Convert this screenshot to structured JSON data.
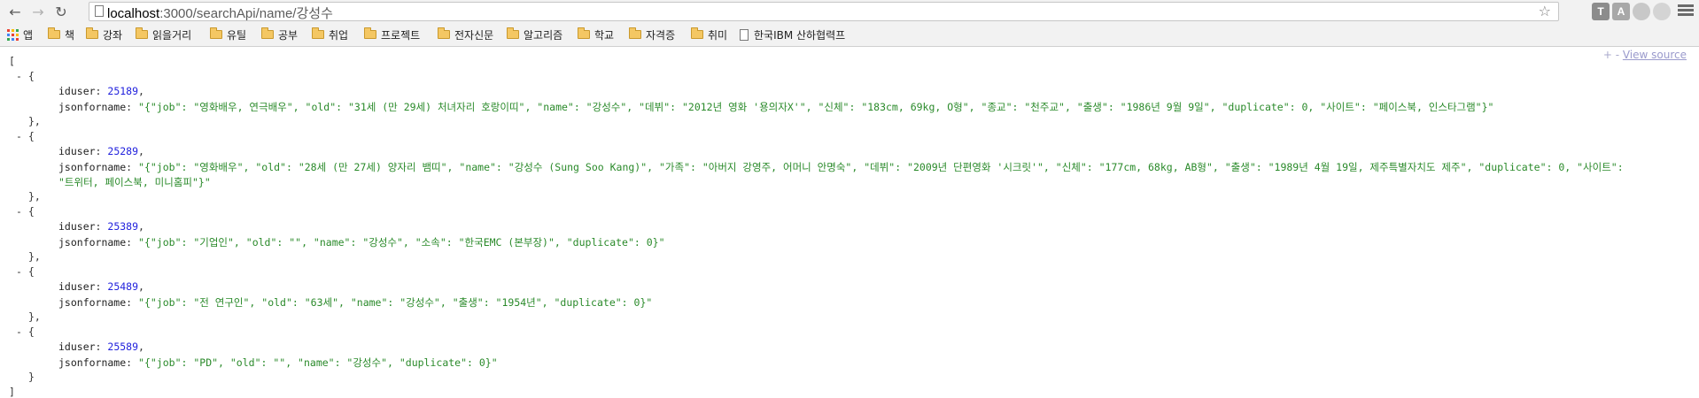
{
  "browser": {
    "url_host": "localhost",
    "url_rest": ":3000/searchApi/name/강성수",
    "extensions": [
      "T",
      "A",
      "",
      ""
    ]
  },
  "bookmarks": [
    {
      "label": "앱",
      "type": "apps"
    },
    {
      "label": "책",
      "type": "folder"
    },
    {
      "label": "강좌",
      "type": "folder"
    },
    {
      "label": "읽을거리",
      "type": "folder"
    },
    {
      "label": "유틸",
      "type": "folder"
    },
    {
      "label": "공부",
      "type": "folder"
    },
    {
      "label": "취업",
      "type": "folder"
    },
    {
      "label": "프로젝트",
      "type": "folder"
    },
    {
      "label": "전자신문",
      "type": "folder"
    },
    {
      "label": "알고리즘",
      "type": "folder"
    },
    {
      "label": "학교",
      "type": "folder"
    },
    {
      "label": "자격증",
      "type": "folder"
    },
    {
      "label": "취미",
      "type": "folder"
    },
    {
      "label": "한국IBM 산하협력프",
      "type": "page"
    }
  ],
  "viewer": {
    "collapse_all": "+ -",
    "view_source": "View source"
  },
  "json": {
    "open_bracket": "[",
    "close_bracket": "]",
    "toggle": "-",
    "open_brace": "{",
    "close_brace_comma": "},",
    "close_brace": "}",
    "key_iduser": "iduser",
    "key_jsonforname": "jsonforname",
    "records": [
      {
        "iduser": "25189",
        "jsonforname": "\"{\"job\": \"영화배우, 연극배우\", \"old\": \"31세 (만 29세) 처녀자리 호랑이띠\", \"name\": \"강성수\", \"데뷔\": \"2012년 영화 '용의자X'\", \"신체\": \"183cm, 69kg, O형\", \"종교\": \"천주교\", \"출생\": \"1986년 9월 9일\", \"duplicate\": 0, \"사이트\": \"페이스북, 인스타그램\"}\""
      },
      {
        "iduser": "25289",
        "jsonforname": "\"{\"job\": \"영화배우\", \"old\": \"28세 (만 27세) 양자리 뱀띠\", \"name\": \"강성수 (Sung Soo Kang)\", \"가족\": \"아버지 강영주, 어머니 안명숙\", \"데뷔\": \"2009년 단편영화 '시크릿'\", \"신체\": \"177cm, 68kg, AB형\", \"출생\": \"1989년 4월 19일, 제주특별자치도 제주\", \"duplicate\": 0, \"사이트\":",
        "jsonforname_cont": "\"트위터, 페이스북, 미니홈피\"}\""
      },
      {
        "iduser": "25389",
        "jsonforname": "\"{\"job\": \"기업인\", \"old\": \"\", \"name\": \"강성수\", \"소속\": \"한국EMC (본부장)\", \"duplicate\": 0}\""
      },
      {
        "iduser": "25489",
        "jsonforname": "\"{\"job\": \"전 연구인\", \"old\": \"63세\", \"name\": \"강성수\", \"출생\": \"1954년\", \"duplicate\": 0}\""
      },
      {
        "iduser": "25589",
        "jsonforname": "\"{\"job\": \"PD\", \"old\": \"\", \"name\": \"강성수\", \"duplicate\": 0}\""
      }
    ]
  }
}
